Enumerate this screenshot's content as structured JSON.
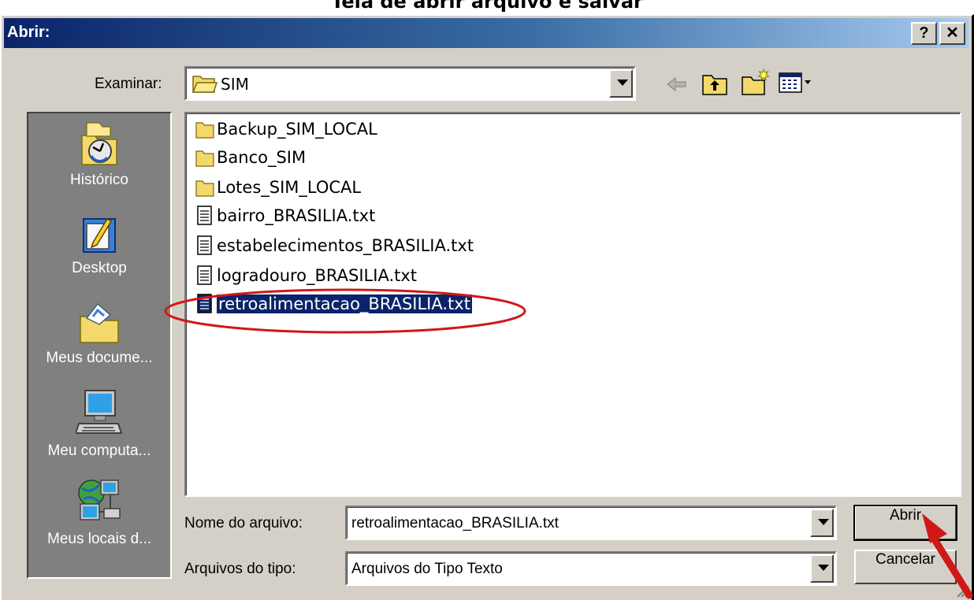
{
  "page_heading": "Tela de abrir arquivo e salvar",
  "dialog": {
    "title": "Abrir:",
    "help_label": "?",
    "close_label": "✕",
    "look_in": {
      "label": "Examinar:",
      "value": "SIM"
    },
    "places": [
      {
        "label": "Histórico",
        "icon": "history-icon"
      },
      {
        "label": "Desktop",
        "icon": "desktop-icon"
      },
      {
        "label": "Meus docume...",
        "icon": "my-documents-icon"
      },
      {
        "label": "Meu computa...",
        "icon": "my-computer-icon"
      },
      {
        "label": "Meus locais d...",
        "icon": "network-places-icon"
      }
    ],
    "files": [
      {
        "name": "Backup_SIM_LOCAL",
        "type": "folder"
      },
      {
        "name": "Banco_SIM",
        "type": "folder"
      },
      {
        "name": "Lotes_SIM_LOCAL",
        "type": "folder"
      },
      {
        "name": "bairro_BRASILIA.txt",
        "type": "text-file"
      },
      {
        "name": "estabelecimentos_BRASILIA.txt",
        "type": "text-file"
      },
      {
        "name": "logradouro_BRASILIA.txt",
        "type": "text-file"
      },
      {
        "name": "retroalimentacao_BRASILIA.txt",
        "type": "text-file",
        "selected": true
      }
    ],
    "filename": {
      "label": "Nome do arquivo:",
      "value": "retroalimentacao_BRASILIA.txt"
    },
    "filetype": {
      "label": "Arquivos do tipo:",
      "value": "Arquivos do Tipo Texto"
    },
    "open_button": "Abrir",
    "cancel_button": "Cancelar"
  },
  "annotation_colors": {
    "highlight_ellipse": "#d01818",
    "arrow": "#d01818"
  }
}
